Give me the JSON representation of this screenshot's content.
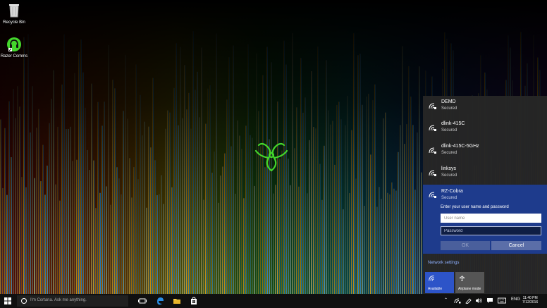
{
  "desktop": {
    "icons": [
      {
        "label": "Recycle Bin"
      },
      {
        "label": "Razer Comms"
      }
    ]
  },
  "networks": [
    {
      "ssid": "DEMD",
      "status": "Secured"
    },
    {
      "ssid": "dlink-415C",
      "status": "Secured"
    },
    {
      "ssid": "dlink-415C-5GHz",
      "status": "Secured"
    },
    {
      "ssid": "linksys",
      "status": "Secured"
    }
  ],
  "selected_network": {
    "ssid": "RZ-Cobra",
    "status": "Secured",
    "prompt": "Enter your user name and password",
    "username_placeholder": "User name",
    "password_placeholder": "Password",
    "ok_label": "OK",
    "cancel_label": "Cancel"
  },
  "network_settings_label": "Network settings",
  "quick_actions": [
    {
      "label": "Available"
    },
    {
      "label": "Airplane mode"
    }
  ],
  "taskbar": {
    "search_placeholder": "I'm Cortana. Ask me anything.",
    "language": "ENG",
    "time": "11:40 PM",
    "date": "7/12/2016"
  },
  "colors": {
    "accent": "#1e3b8c",
    "razer_green": "#44d62c",
    "flyout_bg": "#262626",
    "taskbar_bg": "#101010"
  }
}
